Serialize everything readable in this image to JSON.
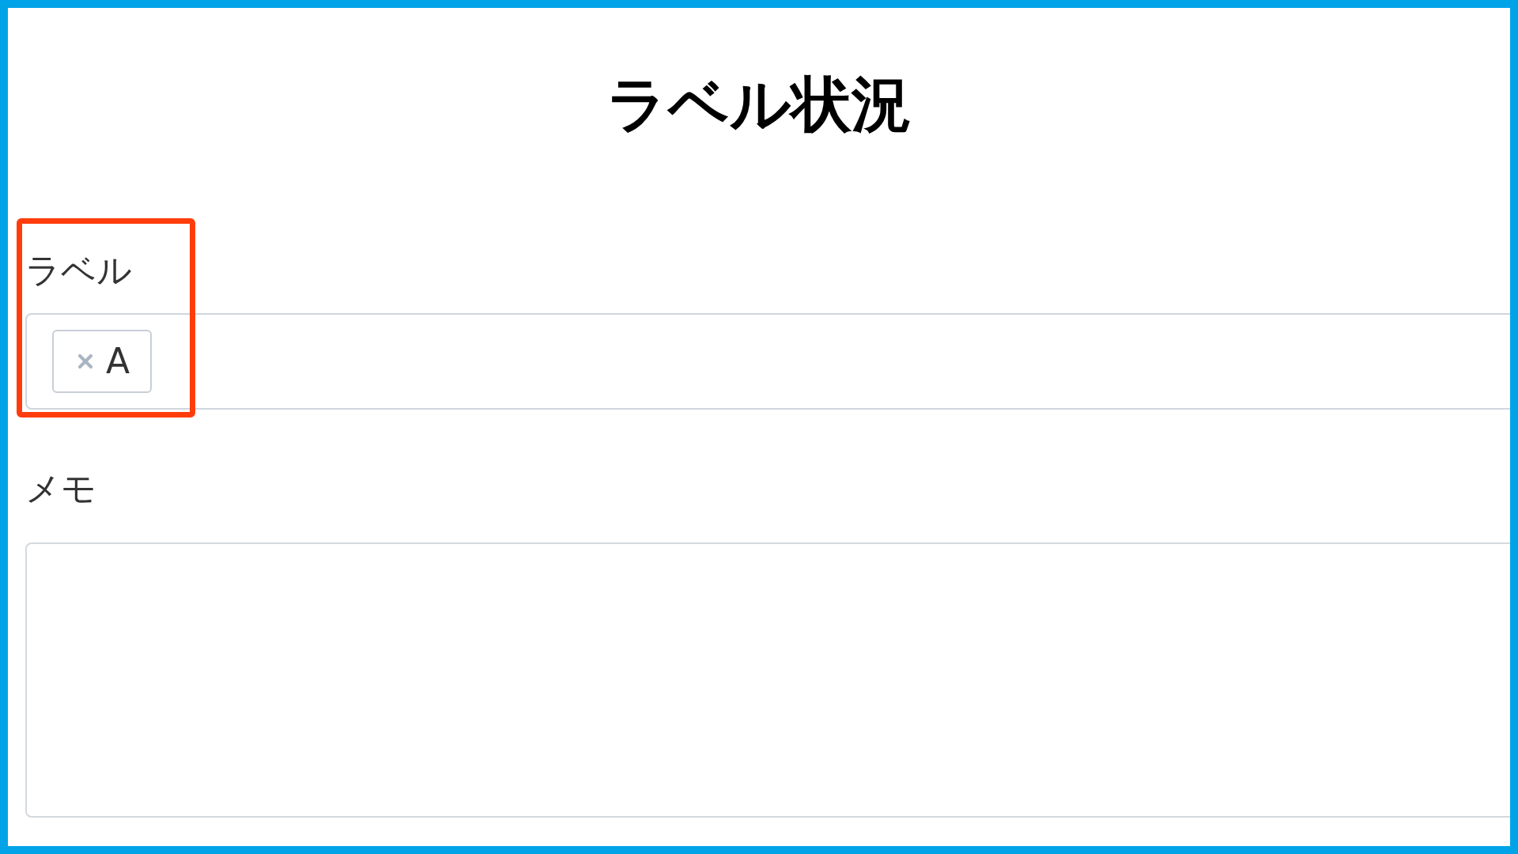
{
  "title": "ラベル状況",
  "label_field": {
    "label": "ラベル",
    "tags": [
      {
        "text": "A"
      }
    ]
  },
  "memo_field": {
    "label": "メモ"
  }
}
